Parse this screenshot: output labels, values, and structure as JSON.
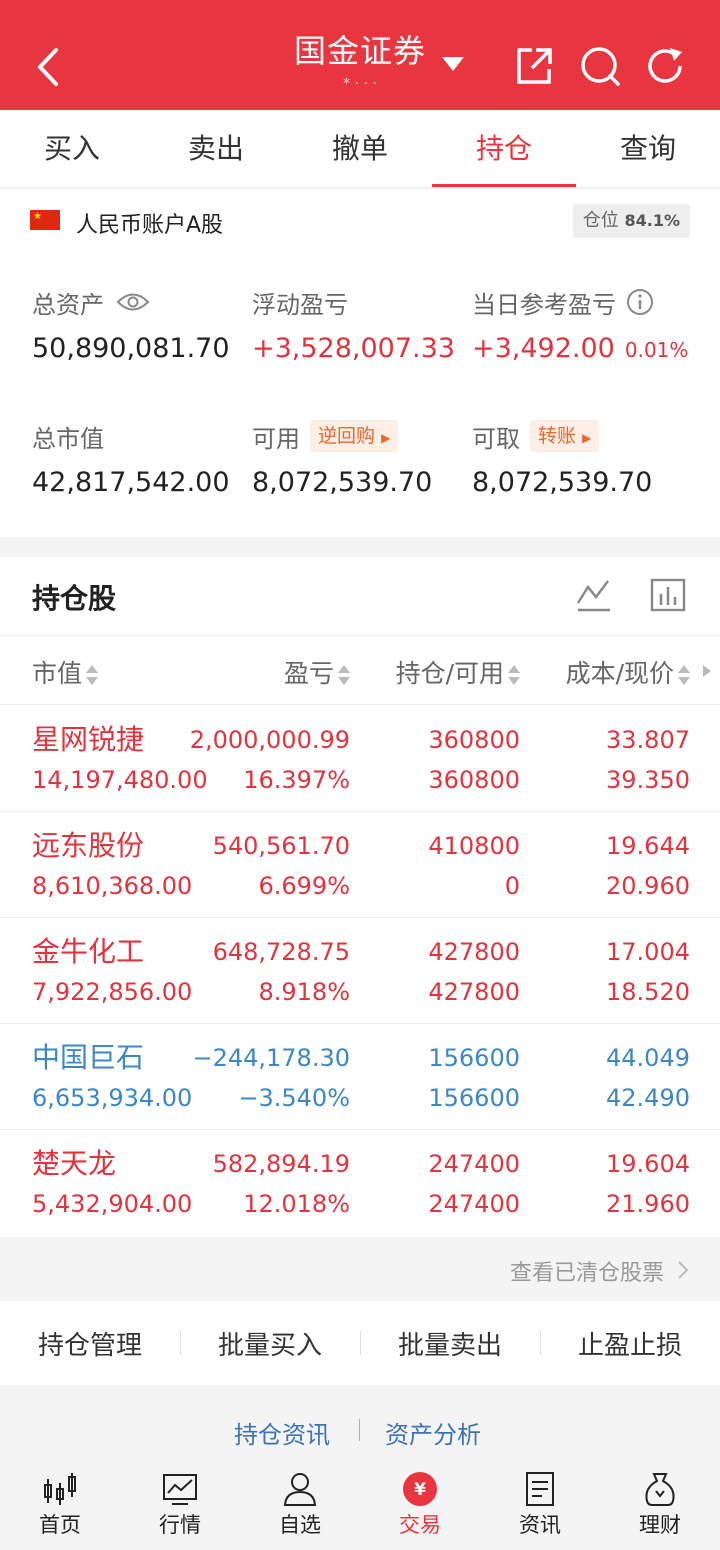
{
  "header": {
    "title": "国金证券",
    "subtitle": "* · · ·"
  },
  "tabs": [
    "买入",
    "卖出",
    "撤单",
    "持仓",
    "查询"
  ],
  "account": {
    "name": "人民币账户A股",
    "position_label": "仓位",
    "position_value": "84.1%",
    "total_assets_label": "总资产",
    "total_assets": "50,890,081.70",
    "floating_pl_label": "浮动盈亏",
    "floating_pl": "+3,528,007.33",
    "daily_pl_label": "当日参考盈亏",
    "daily_pl": "+3,492.00",
    "daily_pl_pct": "0.01%",
    "market_value_label": "总市值",
    "market_value": "42,817,542.00",
    "available_label": "可用",
    "available_chip": "逆回购",
    "available": "8,072,539.70",
    "withdrawable_label": "可取",
    "withdrawable_chip": "转账",
    "withdrawable": "8,072,539.70"
  },
  "holdings": {
    "title": "持仓股",
    "columns": [
      "市值",
      "盈亏",
      "持仓/可用",
      "成本/现价"
    ],
    "rows": [
      {
        "name": "星网锐捷",
        "market_value": "14,197,480.00",
        "pl": "2,000,000.99",
        "pl_pct": "16.397%",
        "position": "360800",
        "available": "360800",
        "cost": "33.807",
        "price": "39.350"
      },
      {
        "name": "远东股份",
        "market_value": "8,610,368.00",
        "pl": "540,561.70",
        "pl_pct": "6.699%",
        "position": "410800",
        "available": "0",
        "cost": "19.644",
        "price": "20.960"
      },
      {
        "name": "金牛化工",
        "market_value": "7,922,856.00",
        "pl": "648,728.75",
        "pl_pct": "8.918%",
        "position": "427800",
        "available": "427800",
        "cost": "17.004",
        "price": "18.520"
      },
      {
        "name": "中国巨石",
        "market_value": "6,653,934.00",
        "pl": "−244,178.30",
        "pl_pct": "−3.540%",
        "position": "156600",
        "available": "156600",
        "cost": "44.049",
        "price": "42.490"
      },
      {
        "name": "楚天龙",
        "market_value": "5,432,904.00",
        "pl": "582,894.19",
        "pl_pct": "12.018%",
        "position": "247400",
        "available": "247400",
        "cost": "19.604",
        "price": "21.960"
      }
    ],
    "cleared_link": "查看已清仓股票"
  },
  "actions": [
    "持仓管理",
    "批量买入",
    "批量卖出",
    "止盈止损"
  ],
  "links": {
    "news": "持仓资讯",
    "analysis": "资产分析"
  },
  "nav": [
    "首页",
    "行情",
    "自选",
    "交易",
    "资讯",
    "理财"
  ],
  "colors": {
    "brand": "#e8353f",
    "up": "#e0343e",
    "down": "#3d88c4"
  }
}
